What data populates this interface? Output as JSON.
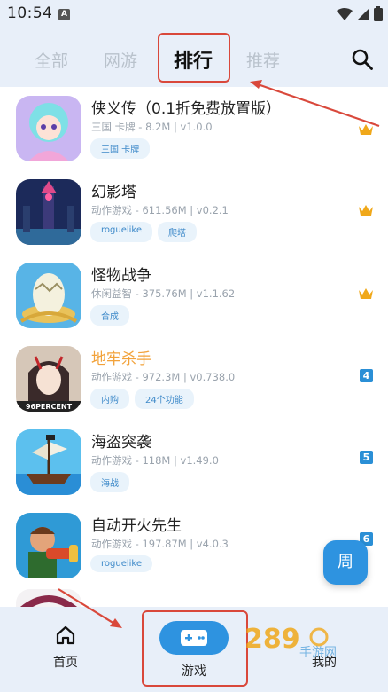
{
  "status_bar": {
    "time": "10:54",
    "notification_badge": "A"
  },
  "tabs": [
    {
      "label": "全部",
      "active": false
    },
    {
      "label": "网游",
      "active": false
    },
    {
      "label": "排行",
      "active": true
    },
    {
      "label": "推荐",
      "active": false
    }
  ],
  "games": [
    {
      "title": "侠义传（0.1折免费放置版）",
      "meta": "三国 卡牌 - 8.2M | v1.0.0",
      "tags": [
        "三国 卡牌"
      ],
      "rank": 1,
      "rank_style": "crown"
    },
    {
      "title": "幻影塔",
      "meta": "动作游戏 - 611.56M | v0.2.1",
      "tags": [
        "roguelike",
        "爬塔"
      ],
      "rank": 2,
      "rank_style": "crown"
    },
    {
      "title": "怪物战争",
      "meta": "休闲益智 - 375.76M | v1.1.62",
      "tags": [
        "合成"
      ],
      "rank": 3,
      "rank_style": "crown"
    },
    {
      "title": "地牢杀手",
      "meta": "动作游戏 - 972.3M | v0.738.0",
      "tags": [
        "内购",
        "24个功能"
      ],
      "rank": "4",
      "rank_style": "number"
    },
    {
      "title": "海盗突袭",
      "meta": "动作游戏 - 118M | v1.49.0",
      "tags": [
        "海战"
      ],
      "rank": "5",
      "rank_style": "number"
    },
    {
      "title": "自动开火先生",
      "meta": "动作游戏 - 197.87M | v4.0.3",
      "tags": [
        "roguelike"
      ],
      "rank": "6",
      "rank_style": "number"
    }
  ],
  "thumb_caption_4": "96PERCENT",
  "fab": {
    "label": "周"
  },
  "bottom_nav": {
    "home": "首页",
    "games": "游戏",
    "mine": "我的"
  },
  "watermark": "289手游网",
  "colors": {
    "accent": "#2e93e0",
    "highlight": "#d9483b",
    "crown": "#f0a81a",
    "orange_title": "#f2a23a"
  }
}
